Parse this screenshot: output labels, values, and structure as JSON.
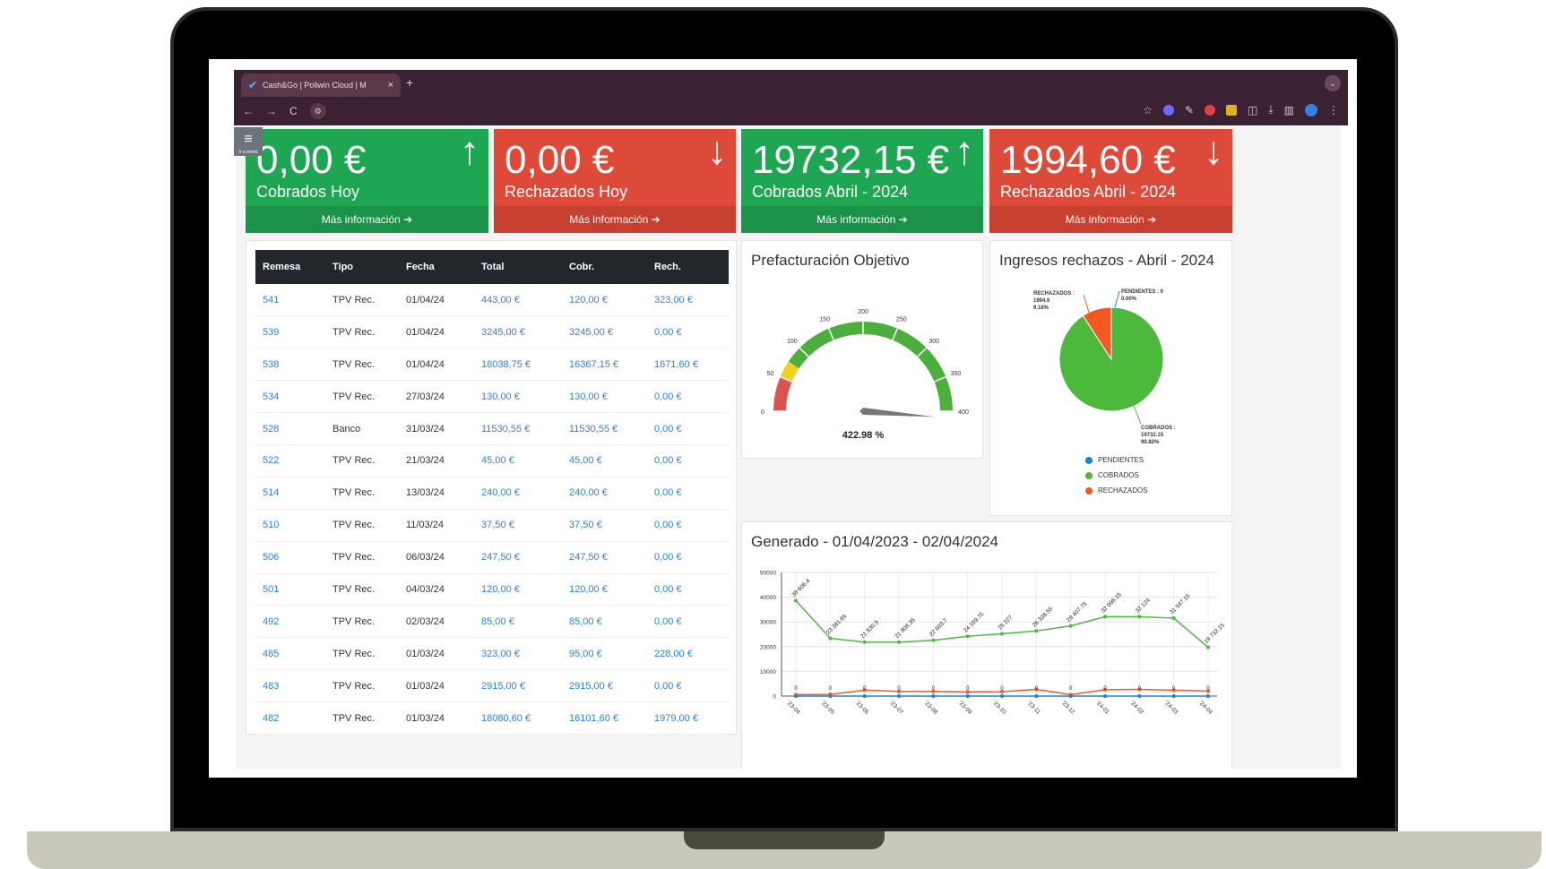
{
  "browser": {
    "tab_title": "Cash&Go | Poliwin Cloud | M",
    "close_glyph": "×",
    "new_tab_glyph": "+",
    "nav": {
      "back": "←",
      "forward": "→",
      "reload": "C"
    }
  },
  "menu_toggle": {
    "glyph": "≡",
    "caption": "Ir a menú"
  },
  "tiles": [
    {
      "value": "0,00 €",
      "label": "Cobrados Hoy",
      "more": "Más información ➔",
      "direction": "up",
      "color": "#1fa652"
    },
    {
      "value": "0,00 €",
      "label": "Rechazados Hoy",
      "more": "Más información ➔",
      "direction": "down",
      "color": "#de4a3a"
    },
    {
      "value": "19732,15 €",
      "label": "Cobrados Abril - 2024",
      "more": "Más información ➔",
      "direction": "up",
      "color": "#1fa652"
    },
    {
      "value": "1994,60 €",
      "label": "Rechazados Abril - 2024",
      "more": "Más información ➔",
      "direction": "down",
      "color": "#de4a3a"
    }
  ],
  "table": {
    "headers": [
      "Remesa",
      "Tipo",
      "Fecha",
      "Total",
      "Cobr.",
      "Rech."
    ],
    "rows": [
      [
        "541",
        "TPV Rec.",
        "01/04/24",
        "443,00 €",
        "120,00 €",
        "323,00 €"
      ],
      [
        "539",
        "TPV Rec.",
        "01/04/24",
        "3245,00 €",
        "3245,00 €",
        "0,00 €"
      ],
      [
        "538",
        "TPV Rec.",
        "01/04/24",
        "18038,75 €",
        "16367,15 €",
        "1671,60 €"
      ],
      [
        "534",
        "TPV Rec.",
        "27/03/24",
        "130,00 €",
        "130,00 €",
        "0,00 €"
      ],
      [
        "528",
        "Banco",
        "31/03/24",
        "11530,55 €",
        "11530,55 €",
        "0,00 €"
      ],
      [
        "522",
        "TPV Rec.",
        "21/03/24",
        "45,00 €",
        "45,00 €",
        "0,00 €"
      ],
      [
        "514",
        "TPV Rec.",
        "13/03/24",
        "240,00 €",
        "240,00 €",
        "0,00 €"
      ],
      [
        "510",
        "TPV Rec.",
        "11/03/24",
        "37,50 €",
        "37,50 €",
        "0,00 €"
      ],
      [
        "506",
        "TPV Rec.",
        "06/03/24",
        "247,50 €",
        "247,50 €",
        "0,00 €"
      ],
      [
        "501",
        "TPV Rec.",
        "04/03/24",
        "120,00 €",
        "120,00 €",
        "0,00 €"
      ],
      [
        "492",
        "TPV Rec.",
        "02/03/24",
        "85,00 €",
        "85,00 €",
        "0,00 €"
      ],
      [
        "485",
        "TPV Rec.",
        "01/03/24",
        "323,00 €",
        "95,00 €",
        "228,00 €"
      ],
      [
        "483",
        "TPV Rec.",
        "01/03/24",
        "2915,00 €",
        "2915,00 €",
        "0,00 €"
      ],
      [
        "482",
        "TPV Rec.",
        "01/03/24",
        "18080,60 €",
        "16101,60 €",
        "1979,00 €"
      ]
    ]
  },
  "gauge": {
    "title": "Prefacturación Objetivo",
    "value_label": "422.98 %"
  },
  "pie": {
    "title": "Ingresos rechazos - Abril - 2024",
    "legend": [
      "PENDIENTES",
      "COBRADOS",
      "RECHAZADOS"
    ]
  },
  "line": {
    "title": "Generado - 01/04/2023 - 02/04/2024"
  },
  "chart_data": [
    {
      "type": "gauge",
      "title": "Prefacturación Objetivo",
      "min": 0,
      "max": 400,
      "ticks": [
        0,
        50,
        100,
        150,
        200,
        250,
        300,
        350,
        400
      ],
      "value": 422.98,
      "value_label": "422.98 %",
      "bands": [
        {
          "from": 0,
          "to": 50,
          "color": "#d9534f"
        },
        {
          "from": 50,
          "to": 75,
          "color": "#f0d020"
        },
        {
          "from": 75,
          "to": 400,
          "color": "#4cae3c"
        }
      ]
    },
    {
      "type": "pie",
      "title": "Ingresos rechazos - Abril - 2024",
      "slices": [
        {
          "name": "PENDIENTES",
          "value": 0,
          "percent": "0.00%",
          "label": "PENDIENTES : 0",
          "color": "#1f7fd0"
        },
        {
          "name": "COBRADOS",
          "value": 19732.15,
          "percent": "90.82%",
          "label": "COBRADOS : 19732.15",
          "color": "#4cb83c"
        },
        {
          "name": "RECHAZADOS",
          "value": 1994.6,
          "percent": "9.18%",
          "label": "RECHAZADOS : 1994.6",
          "color": "#f05a22"
        }
      ],
      "legend_position": "bottom"
    },
    {
      "type": "line",
      "title": "Generado - 01/04/2023 - 02/04/2024",
      "categories": [
        "2023-04",
        "2023-05",
        "2023-06",
        "2023-07",
        "2023-08",
        "2023-09",
        "2023-10",
        "2023-11",
        "2023-12",
        "2024-01",
        "2024-02",
        "2024-03",
        "2024-04"
      ],
      "tick_labels": [
        "'23-04",
        "'23-05",
        "'23-06",
        "'23-07",
        "'23-08",
        "'23-09",
        "'23-10",
        "'23-11",
        "'23-12",
        "'24-01",
        "'24-02",
        "'24-03",
        "'24-04"
      ],
      "ylim": [
        0,
        50000
      ],
      "yticks": [
        0,
        10000,
        20000,
        30000,
        40000,
        50000
      ],
      "grid": true,
      "series": [
        {
          "color": "#4cb83c",
          "values": [
            38606.4,
            23381.65,
            21830.9,
            21808.35,
            22603.7,
            24169.75,
            25227,
            26338.55,
            28407.75,
            32098.15,
            32124,
            31547.15,
            19732.15
          ],
          "labels": [
            "38 606.4",
            "23 381.65",
            "21 830.9",
            "21 808.35",
            "22 603.7",
            "24 169.75",
            "25 227",
            "26 338.55",
            "28 407.75",
            "32 098.15",
            "32 124",
            "31 547.15",
            "19 732.15"
          ]
        },
        {
          "color": "#f05a22",
          "values": [
            600,
            700,
            2400,
            1900,
            1900,
            1700,
            1800,
            2700,
            600,
            2600,
            2700,
            2400,
            2000
          ]
        },
        {
          "color": "#1f7fd0",
          "values": [
            0,
            0,
            0,
            0,
            0,
            0,
            0,
            0,
            0,
            0,
            0,
            0,
            0
          ],
          "labels": [
            "0",
            "0",
            "0",
            "0",
            "0",
            "0",
            "0",
            "0",
            "0",
            "0",
            "0",
            "0",
            "0"
          ]
        }
      ]
    }
  ]
}
